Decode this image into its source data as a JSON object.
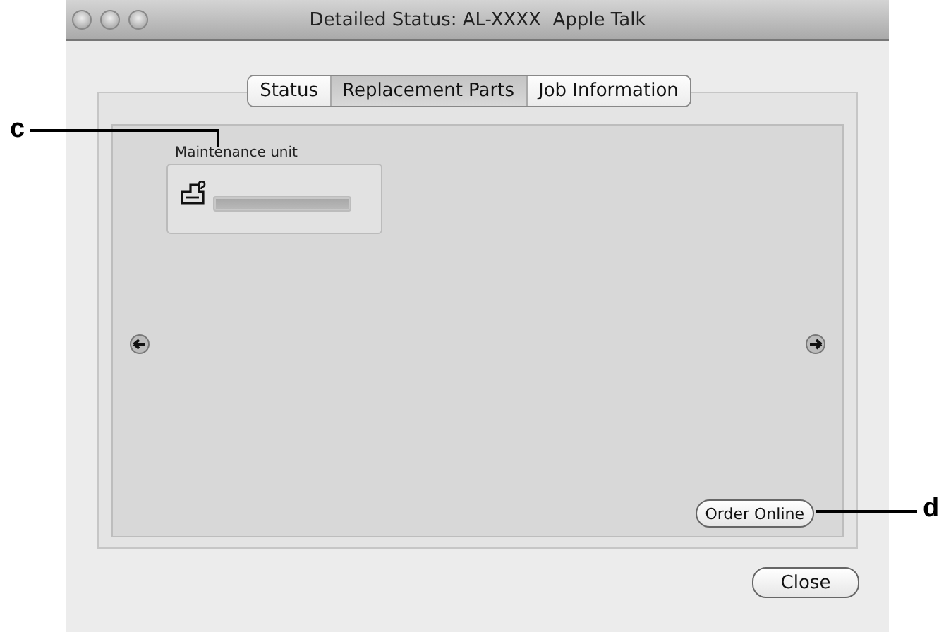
{
  "window": {
    "title": "Detailed Status: AL-XXXX  Apple Talk"
  },
  "tabs": [
    {
      "label": "Status",
      "selected": false
    },
    {
      "label": "Replacement Parts",
      "selected": true
    },
    {
      "label": "Job Information",
      "selected": false
    }
  ],
  "parts": [
    {
      "name": "Maintenance unit",
      "level": 1
    }
  ],
  "order_button": "Order Online",
  "close_button": "Close",
  "callouts": [
    {
      "label": "c",
      "kind": "top-left"
    },
    {
      "label": "d",
      "kind": "bottom-right"
    }
  ]
}
